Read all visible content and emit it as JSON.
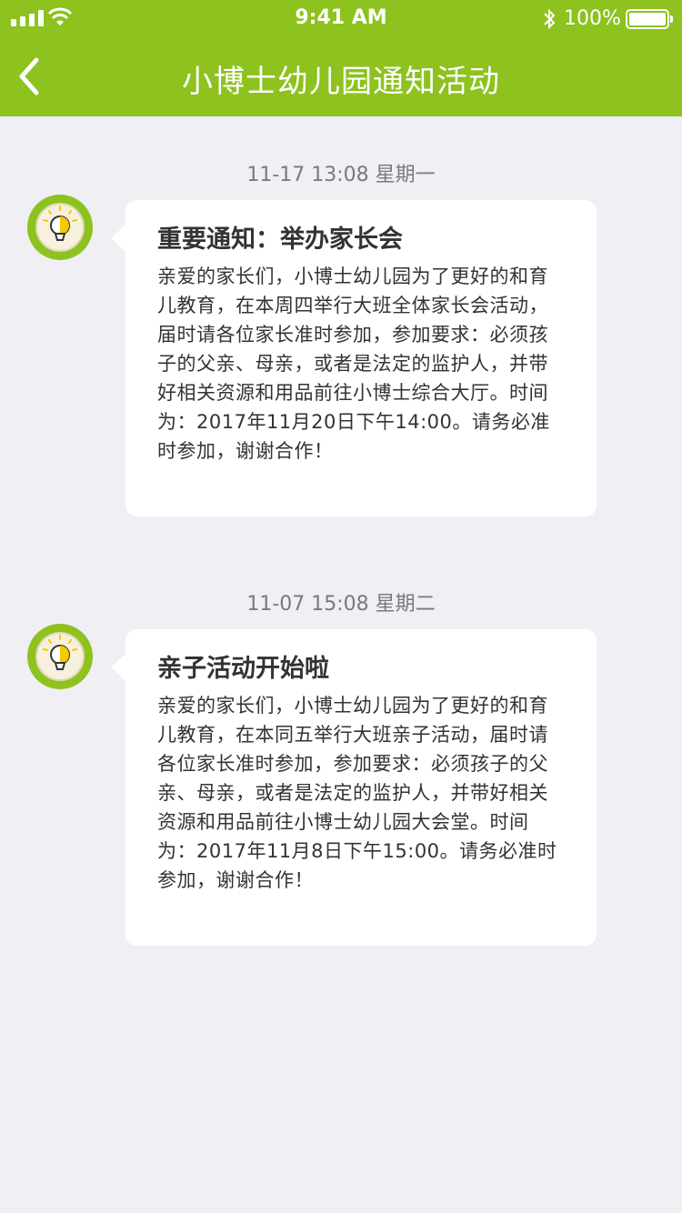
{
  "status_bar": {
    "time": "9:41 AM",
    "battery": "100%",
    "icons": [
      "signal-icon",
      "wifi-icon",
      "bluetooth-icon",
      "battery-icon"
    ]
  },
  "header": {
    "title": "小博士幼儿园通知活动",
    "back_icon": "chevron-left-icon"
  },
  "colors": {
    "brand_green": "#8dc21f",
    "background": "#efeff4",
    "card": "#ffffff",
    "date_text": "#7a7a7a"
  },
  "messages": [
    {
      "date": "11-17 13:08 星期一",
      "title": "重要通知：举办家长会",
      "body": "亲爱的家长们，小博士幼儿园为了更好的和育儿教育，在本周四举行大班全体家长会活动，届时请各位家长准时参加，参加要求：必须孩子的父亲、母亲，或者是法定的监护人，并带好相关资源和用品前往小博士综合大厅。时间为：2017年11月20日下午14:00。请务必准时参加，谢谢合作！",
      "avatar_icon": "lightbulb-icon"
    },
    {
      "date": "11-07 15:08 星期二",
      "title": "亲子活动开始啦",
      "body": "亲爱的家长们，小博士幼儿园为了更好的和育儿教育，在本同五举行大班亲子活动，届时请各位家长准时参加，参加要求：必须孩子的父亲、母亲，或者是法定的监护人，并带好相关资源和用品前往小博士幼儿园大会堂。时间为：2017年11月8日下午15:00。请务必准时参加，谢谢合作！",
      "avatar_icon": "lightbulb-icon"
    }
  ]
}
